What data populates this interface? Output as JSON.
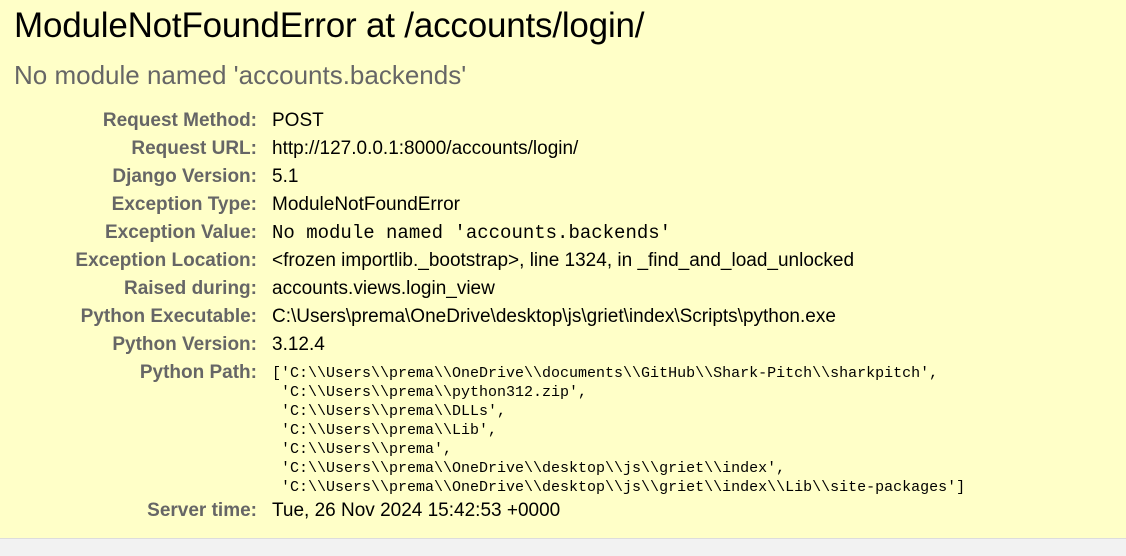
{
  "title": "ModuleNotFoundError at /accounts/login/",
  "subtitle": "No module named 'accounts.backends'",
  "meta": {
    "request_method": {
      "label": "Request Method:",
      "value": "POST"
    },
    "request_url": {
      "label": "Request URL:",
      "value": "http://127.0.0.1:8000/accounts/login/"
    },
    "django_version": {
      "label": "Django Version:",
      "value": "5.1"
    },
    "exception_type": {
      "label": "Exception Type:",
      "value": "ModuleNotFoundError"
    },
    "exception_value": {
      "label": "Exception Value:",
      "value": "No module named 'accounts.backends'"
    },
    "exception_location": {
      "label": "Exception Location:",
      "value": "<frozen importlib._bootstrap>, line 1324, in _find_and_load_unlocked"
    },
    "raised_during": {
      "label": "Raised during:",
      "value": "accounts.views.login_view"
    },
    "python_executable": {
      "label": "Python Executable:",
      "value": "C:\\Users\\prema\\OneDrive\\desktop\\js\\griet\\index\\Scripts\\python.exe"
    },
    "python_version": {
      "label": "Python Version:",
      "value": "3.12.4"
    },
    "python_path": {
      "label": "Python Path:",
      "lines": [
        "['C:\\\\Users\\\\prema\\\\OneDrive\\\\documents\\\\GitHub\\\\Shark-Pitch\\\\sharkpitch',",
        " 'C:\\\\Users\\\\prema\\\\python312.zip',",
        " 'C:\\\\Users\\\\prema\\\\DLLs',",
        " 'C:\\\\Users\\\\prema\\\\Lib',",
        " 'C:\\\\Users\\\\prema',",
        " 'C:\\\\Users\\\\prema\\\\OneDrive\\\\desktop\\\\js\\\\griet\\\\index',",
        " 'C:\\\\Users\\\\prema\\\\OneDrive\\\\desktop\\\\js\\\\griet\\\\index\\\\Lib\\\\site-packages']"
      ]
    },
    "server_time": {
      "label": "Server time:",
      "value": "Tue, 26 Nov 2024 15:42:53 +0000"
    }
  },
  "colors": {
    "summary_background": "#ffffc8",
    "label_text": "#666666",
    "page_background": "#f2f2f2"
  }
}
